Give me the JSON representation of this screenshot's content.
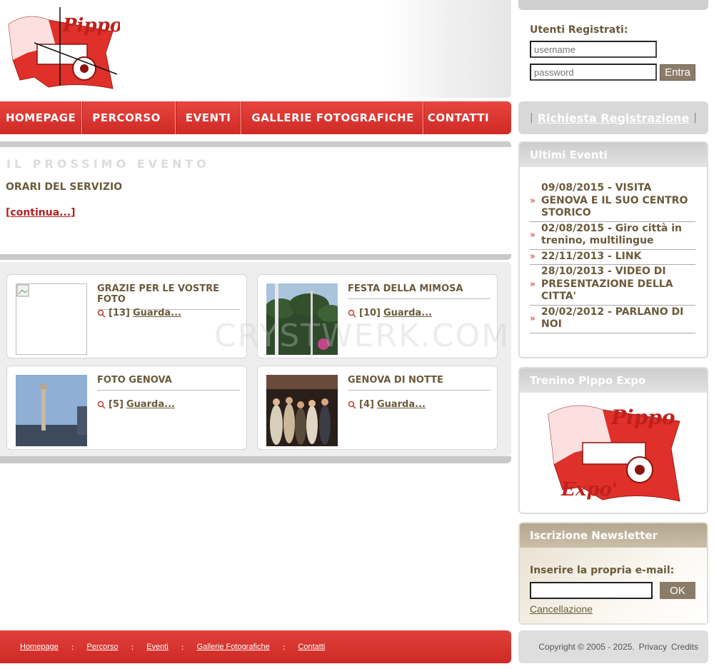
{
  "nav": {
    "items": [
      {
        "label": "HOMEPAGE"
      },
      {
        "label": "PERCORSO"
      },
      {
        "label": "EVENTI"
      },
      {
        "label": "GALLERIE FOTOGRAFICHE"
      },
      {
        "label": "CONTATTI"
      }
    ]
  },
  "next_event": {
    "heading": "IL PROSSIMO EVENTO",
    "title": "ORARI DEL SERVIZIO",
    "more_link": "continua...",
    "bracket_open": "[",
    "bracket_close": "]"
  },
  "galleries": [
    {
      "title": "GRAZIE PER LE VOSTRE FOTO",
      "count": "[13]",
      "link": "Guarda..."
    },
    {
      "title": "FESTA DELLA MIMOSA",
      "count": "[10]",
      "link": "Guarda..."
    },
    {
      "title": "FOTO GENOVA",
      "count": "[5]",
      "link": "Guarda..."
    },
    {
      "title": "GENOVA DI NOTTE",
      "count": "[4]",
      "link": "Guarda..."
    }
  ],
  "login": {
    "label": "Utenti Registrati:",
    "username_placeholder": "username",
    "password_placeholder": "password",
    "submit": "Entra"
  },
  "registration": {
    "link": "Richiesta Registrazione",
    "sep": "|"
  },
  "latest_events": {
    "title": "Ultimi Eventi",
    "items": [
      {
        "text": "09/08/2015 - VISITA GENOVA E IL SUO CENTRO STORICO"
      },
      {
        "text": "02/08/2015 - Giro città in trenino, multilingue"
      },
      {
        "text": "22/11/2013 - LINK"
      },
      {
        "text": "28/10/2013 - VIDEO DI PRESENTAZIONE DELLA CITTA'"
      },
      {
        "text": "20/02/2012 - PARLANO DI NOI"
      }
    ],
    "arrow": "»"
  },
  "expo": {
    "title": "Trenino Pippo Expo",
    "logo_text": "Expo'"
  },
  "newsletter": {
    "title": "Iscrizione Newsletter",
    "label": "Inserire la propria e-mail:",
    "submit": "OK",
    "cancel": "Cancellazione"
  },
  "footer": {
    "links": [
      {
        "label": "Homepage"
      },
      {
        "label": "Percorso"
      },
      {
        "label": "Eventi"
      },
      {
        "label": "Gallerie Fotografiche"
      },
      {
        "label": "Contatti"
      }
    ],
    "sep": ":"
  },
  "copyright": {
    "text": "Copyright © 2005 - 2025.",
    "privacy": "Privacy",
    "credits": "Credits"
  },
  "logo": {
    "text": "Pippo"
  },
  "watermark": "CRYSTWERK.COM",
  "colors": {
    "brand_red": "#cf2a25",
    "text_brown": "#6b5a3a",
    "button_taupe": "#8a7c68"
  }
}
